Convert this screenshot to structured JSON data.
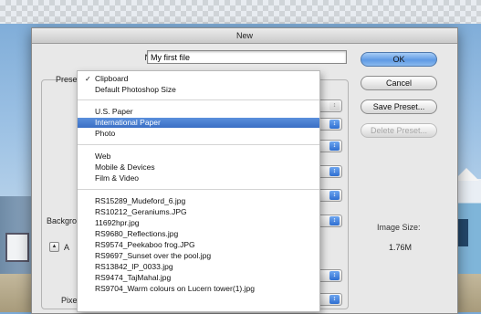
{
  "dialog": {
    "title": "New",
    "name_label": "Name:",
    "name_value": "My first file",
    "preset_label": "Preset",
    "background_label": "Backgro",
    "advanced_label": "A",
    "pixel_label": "Pixe",
    "image_size_label": "Image Size:",
    "image_size_value": "1.76M"
  },
  "buttons": {
    "ok": "OK",
    "cancel": "Cancel",
    "save_preset": "Save Preset...",
    "delete_preset": "Delete Preset..."
  },
  "preset_menu": {
    "checked_item": "Clipboard",
    "selected_item": "International Paper",
    "items": [
      "Clipboard",
      "Default Photoshop Size",
      "U.S. Paper",
      "International Paper",
      "Photo",
      "Web",
      "Mobile & Devices",
      "Film & Video",
      "RS15289_Mudeford_6.jpg",
      "RS10212_Geraniums.JPG",
      "11692hpr.jpg",
      "RS9680_Reflections.jpg",
      "RS9574_Peekaboo frog.JPG",
      "RS9697_Sunset over the pool.jpg",
      "RS13842_IP_0033.jpg",
      "RS9474_TajMahal.jpg",
      "RS9704_Warm colours on Lucern tower(1).jpg"
    ]
  },
  "icons": {
    "select_arrows": "updown-arrows-icon",
    "advanced_toggle": "disclosure-triangle-icon",
    "checkmark": "checkmark-icon"
  },
  "colors": {
    "primary_button": "#5f9ae4",
    "menu_highlight": "#3a6fc4",
    "select_arrow": "#2f6fd1"
  }
}
